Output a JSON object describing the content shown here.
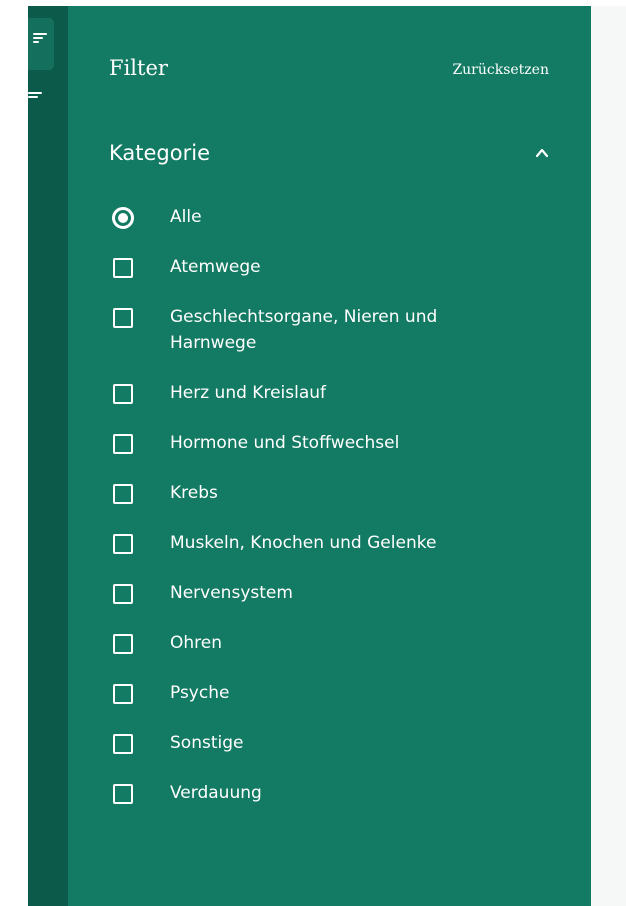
{
  "panel": {
    "title": "Filter",
    "reset_label": "Zurücksetzen"
  },
  "section": {
    "title": "Kategorie",
    "expanded": true
  },
  "options": [
    {
      "label": "Alle",
      "type": "radio",
      "checked": true
    },
    {
      "label": "Atemwege",
      "type": "checkbox",
      "checked": false
    },
    {
      "label": "Geschlechtsorgane, Nieren und Harnwege",
      "type": "checkbox",
      "checked": false
    },
    {
      "label": "Herz und Kreislauf",
      "type": "checkbox",
      "checked": false
    },
    {
      "label": "Hormone und Stoffwechsel",
      "type": "checkbox",
      "checked": false
    },
    {
      "label": "Krebs",
      "type": "checkbox",
      "checked": false
    },
    {
      "label": "Muskeln, Knochen und Gelenke",
      "type": "checkbox",
      "checked": false
    },
    {
      "label": "Nervensystem",
      "type": "checkbox",
      "checked": false
    },
    {
      "label": "Ohren",
      "type": "checkbox",
      "checked": false
    },
    {
      "label": "Psyche",
      "type": "checkbox",
      "checked": false
    },
    {
      "label": "Sonstige",
      "type": "checkbox",
      "checked": false
    },
    {
      "label": "Verdauung",
      "type": "checkbox",
      "checked": false
    }
  ],
  "icons": {
    "rail_toggle": "filter-lines-icon",
    "collapse": "chevron-up-icon",
    "selected": "radio-checked-icon",
    "unselected": "checkbox-empty-icon"
  },
  "colors": {
    "panel_bg": "#137a63",
    "rail_bg": "#0b5a4a",
    "text": "#ffffff"
  }
}
